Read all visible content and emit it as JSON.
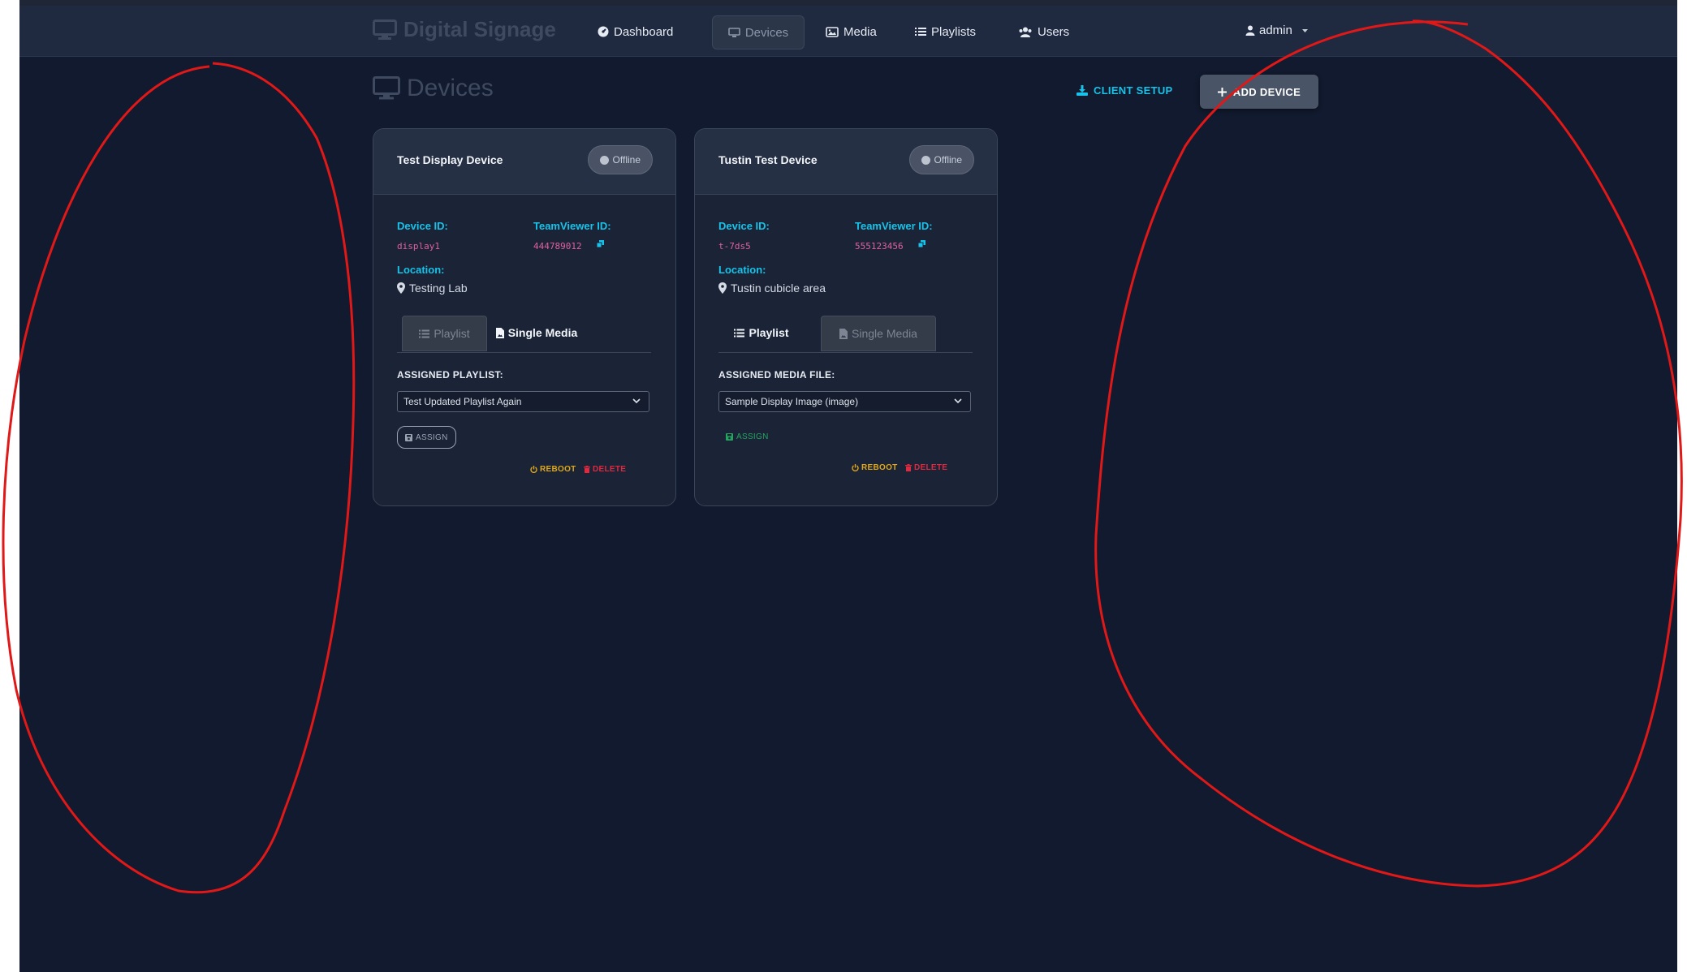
{
  "colors": {
    "background": "#111a2e",
    "navbar": "#1f2a40",
    "accent": "#19c2e8",
    "id_pink": "#e35fa0",
    "warning": "#e0a819",
    "danger": "#e0283f",
    "success": "#23a55f",
    "annotation": "#e01818"
  },
  "nav": {
    "brand": "Digital Signage",
    "links": [
      {
        "label": "Dashboard",
        "icon": "gauge-icon"
      },
      {
        "label": "Devices",
        "icon": "desktop-icon",
        "active": true
      },
      {
        "label": "Media",
        "icon": "images-icon"
      },
      {
        "label": "Playlists",
        "icon": "list-icon"
      },
      {
        "label": "Users",
        "icon": "users-icon"
      }
    ],
    "user": "admin"
  },
  "page": {
    "title": "Devices",
    "client_setup": "CLIENT SETUP",
    "add_device": "ADD DEVICE"
  },
  "devices": [
    {
      "name": "Test Display Device",
      "status": "Offline",
      "device_id_label": "Device ID:",
      "device_id": "display1",
      "teamviewer_label": "TeamViewer ID:",
      "teamviewer_id": "444789012",
      "location_label": "Location:",
      "location": "Testing Lab",
      "tab_playlist": "Playlist",
      "tab_single_media": "Single Media",
      "active_tab": "single_media_styled_bold",
      "assigned_label": "ASSIGNED PLAYLIST:",
      "selected": "Test Updated Playlist Again",
      "assign": "ASSIGN",
      "reboot": "REBOOT",
      "delete": "DELETE"
    },
    {
      "name": "Tustin Test Device",
      "status": "Offline",
      "device_id_label": "Device ID:",
      "device_id": "t-7ds5",
      "teamviewer_label": "TeamViewer ID:",
      "teamviewer_id": "555123456",
      "location_label": "Location:",
      "location": "Tustin cubicle area",
      "tab_playlist": "Playlist",
      "tab_single_media": "Single Media",
      "assigned_label": "ASSIGNED MEDIA FILE:",
      "selected": "Sample Display Image (image)",
      "assign": "ASSIGN",
      "reboot": "REBOOT",
      "delete": "DELETE"
    }
  ]
}
